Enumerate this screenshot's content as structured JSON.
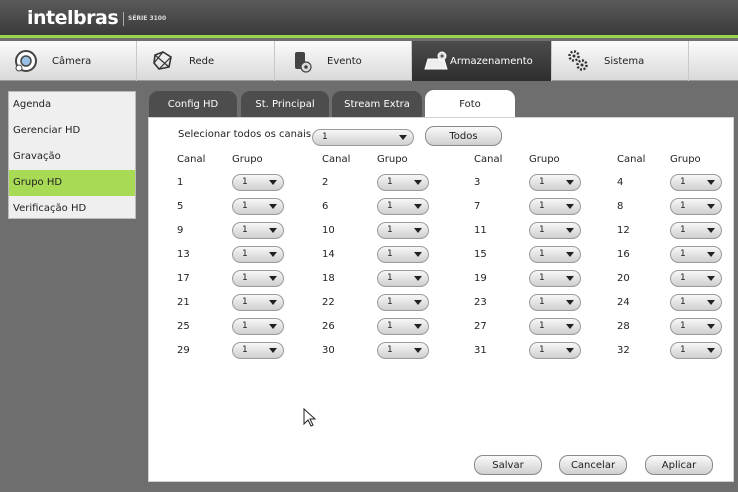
{
  "brand": {
    "name": "intelbras",
    "series": "SÉRIE 3100"
  },
  "menu": [
    {
      "label": "Câmera",
      "icon": "camera-icon"
    },
    {
      "label": "Rede",
      "icon": "network-icon"
    },
    {
      "label": "Evento",
      "icon": "event-icon"
    },
    {
      "label": "Armazenamento",
      "icon": "storage-icon",
      "active": true
    },
    {
      "label": "Sistema",
      "icon": "system-gears-icon"
    }
  ],
  "sidebar": [
    {
      "label": "Agenda"
    },
    {
      "label": "Gerenciar HD"
    },
    {
      "label": "Gravação"
    },
    {
      "label": "Grupo HD",
      "active": true
    },
    {
      "label": "Verificação HD"
    }
  ],
  "tabs": [
    {
      "label": "Config HD"
    },
    {
      "label": "St. Principal"
    },
    {
      "label": "Stream Extra"
    },
    {
      "label": "Foto",
      "active": true
    }
  ],
  "select_all": {
    "label": "Selecionar todos os canais",
    "value": "1",
    "button": "Todos"
  },
  "headers": {
    "channel": "Canal",
    "group": "Grupo"
  },
  "channels": [
    "1",
    "2",
    "3",
    "4",
    "5",
    "6",
    "7",
    "8",
    "9",
    "10",
    "11",
    "12",
    "13",
    "14",
    "15",
    "16",
    "17",
    "18",
    "19",
    "20",
    "21",
    "22",
    "23",
    "24",
    "25",
    "26",
    "27",
    "28",
    "29",
    "30",
    "31",
    "32"
  ],
  "group_values": [
    "1",
    "1",
    "1",
    "1",
    "1",
    "1",
    "1",
    "1",
    "1",
    "1",
    "1",
    "1",
    "1",
    "1",
    "1",
    "1",
    "1",
    "1",
    "1",
    "1",
    "1",
    "1",
    "1",
    "1",
    "1",
    "1",
    "1",
    "1",
    "1",
    "1",
    "1",
    "1"
  ],
  "buttons": {
    "save": "Salvar",
    "cancel": "Cancelar",
    "apply": "Aplicar"
  },
  "colors": {
    "accent": "#9bd24c",
    "sidebar_active": "#a8da55",
    "tab_dark": "#4d4d4d"
  }
}
